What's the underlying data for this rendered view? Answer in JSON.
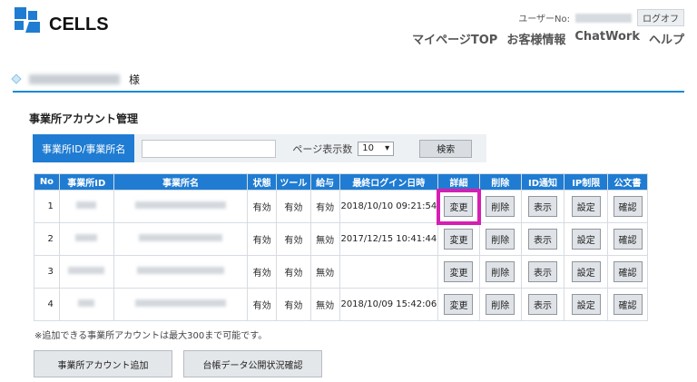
{
  "header": {
    "logo_text": "CELLS",
    "user_label": "ユーザーNo:",
    "logout_label": "ログオフ",
    "nav": [
      "マイページTOP",
      "お客様情報",
      "ChatWork",
      "ヘルプ"
    ]
  },
  "customer": {
    "suffix": "様"
  },
  "page_title": "事業所アカウント管理",
  "search": {
    "label": "事業所ID/事業所名",
    "per_page_label": "ページ表示数",
    "per_page_value": "10",
    "search_button": "検索"
  },
  "table": {
    "headers": [
      "No",
      "事業所ID",
      "事業所名",
      "状態",
      "ツール",
      "給与",
      "最終ログイン日時",
      "詳細",
      "削除",
      "ID通知",
      "IP制限",
      "公文書"
    ],
    "rows": [
      {
        "no": "1",
        "status": "有効",
        "tool": "有効",
        "salary": "有効",
        "last_login": "2018/10/10 09:21:54"
      },
      {
        "no": "2",
        "status": "有効",
        "tool": "有効",
        "salary": "無効",
        "last_login": "2017/12/15 10:41:44"
      },
      {
        "no": "3",
        "status": "有効",
        "tool": "有効",
        "salary": "無効",
        "last_login": ""
      },
      {
        "no": "4",
        "status": "有効",
        "tool": "有効",
        "salary": "無効",
        "last_login": "2018/10/09 15:42:06"
      }
    ],
    "buttons": {
      "detail": "変更",
      "delete": "削除",
      "notify": "表示",
      "ip": "設定",
      "doc": "確認"
    }
  },
  "note": "※追加できる事業所アカウントは最大300まで可能です。",
  "bottom_buttons": {
    "add": "事業所アカウント追加",
    "ledger": "台帳データ公開状況確認"
  },
  "colors": {
    "primary_blue": "#1f7cd2",
    "highlight": "#d61fb2"
  }
}
